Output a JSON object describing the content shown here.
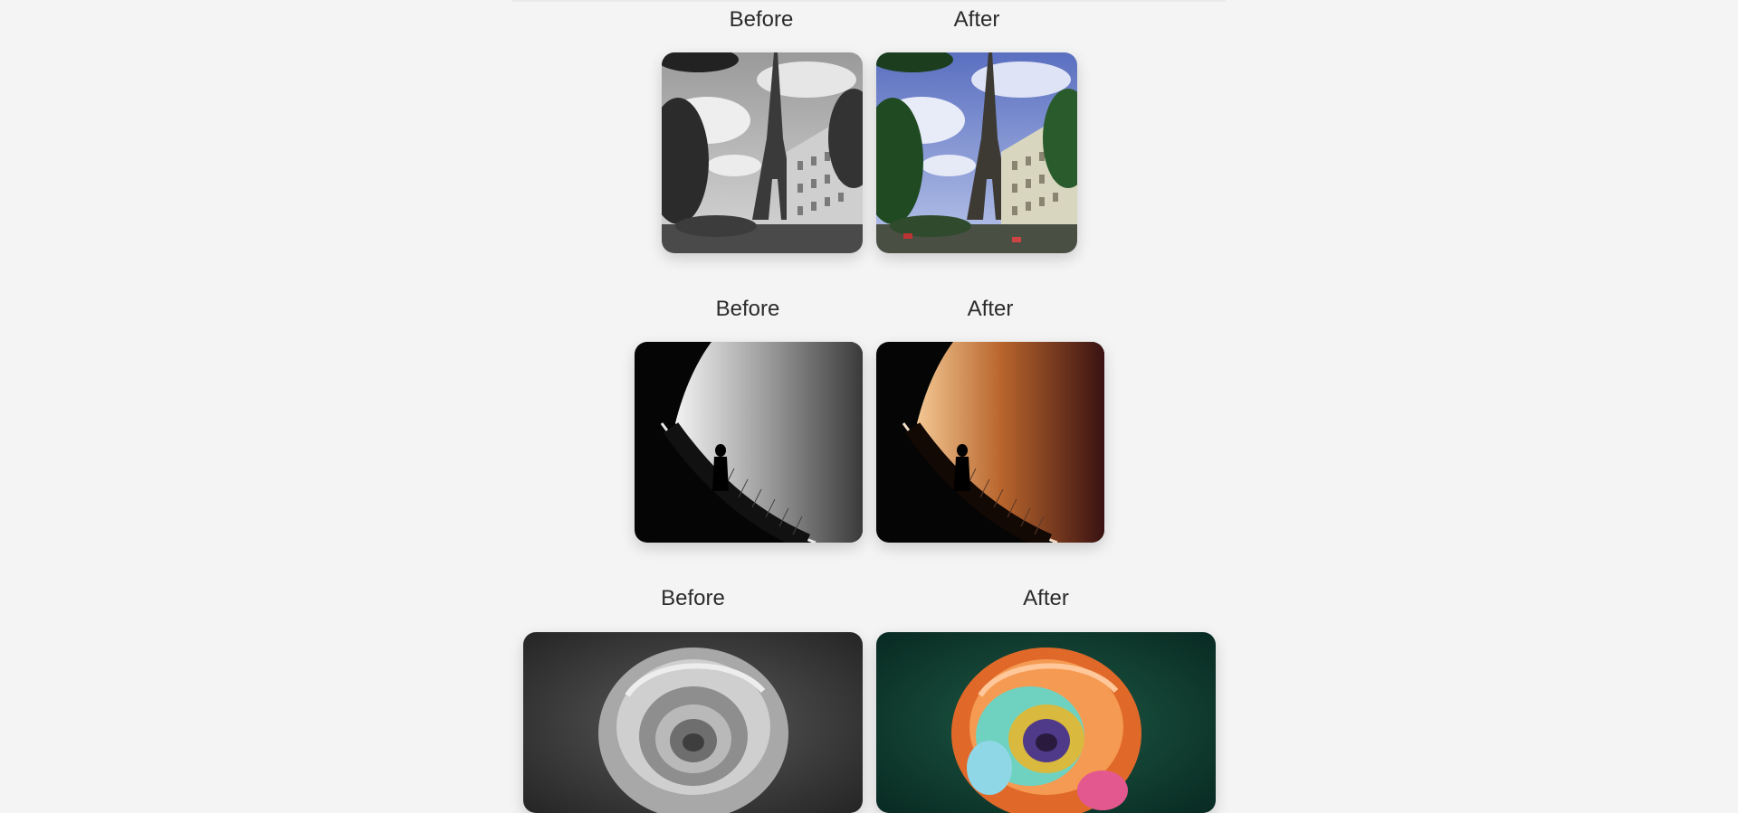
{
  "comparisons": [
    {
      "before_label": "Before",
      "after_label": "After",
      "subject": "eiffel-tower"
    },
    {
      "before_label": "Before",
      "after_label": "After",
      "subject": "spiral-staircase"
    },
    {
      "before_label": "Before",
      "after_label": "After",
      "subject": "rose"
    }
  ],
  "colors": {
    "page_background": "#f4f4f4",
    "text": "#2b2b2b"
  }
}
